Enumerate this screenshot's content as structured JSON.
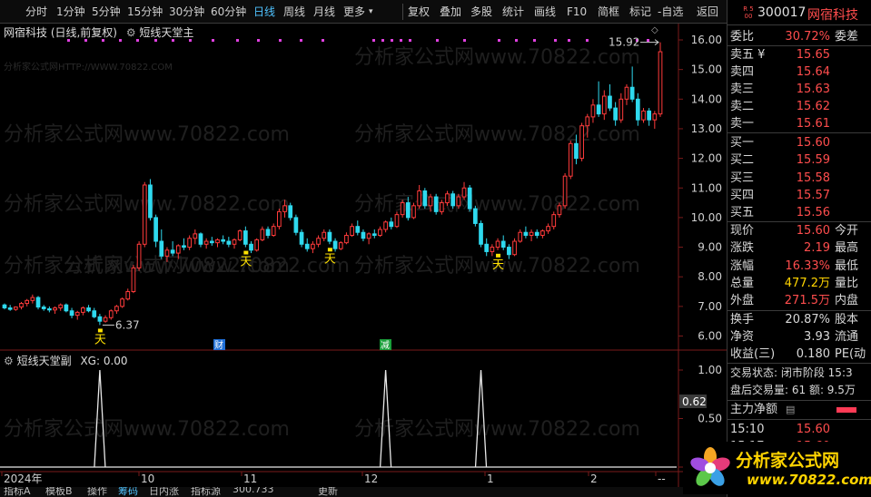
{
  "toolbar": {
    "periods": [
      "分时",
      "1分钟",
      "5分钟",
      "15分钟",
      "30分钟",
      "60分钟",
      "日线",
      "周线",
      "月线",
      "更多"
    ],
    "active_period": "日线",
    "tools": [
      "复权",
      "叠加",
      "多股",
      "统计",
      "画线",
      "F10",
      "简框",
      "标记",
      "-自选",
      "返回"
    ]
  },
  "chart": {
    "title": "网宿科技 (日线,前复权)",
    "indicator": "短线天堂主",
    "watermark": "分析家公式网www.70822.com",
    "watermark_small": "分析家公式网HTTP://WWW.70822.COM",
    "high_label": "15.92",
    "low_label": "6.37",
    "signal_char": "天",
    "event_marks": [
      {
        "text": "财",
        "color": "#1f6fd8"
      },
      {
        "text": "减",
        "color": "#1a9e3a"
      }
    ]
  },
  "subchart": {
    "title": "短线天堂副",
    "xg_label": "XG: 0.00",
    "cursor_value": "0.62"
  },
  "xaxis": {
    "labels": [
      "2024年",
      "10",
      "11",
      "12",
      "1",
      "2",
      "--"
    ]
  },
  "right_panel": {
    "badge": "R 500",
    "code": "300017",
    "name": "网宿科技",
    "webi": {
      "label": "委比",
      "value": "30.72%",
      "right": "委差"
    },
    "asks": [
      {
        "label": "卖五 ¥",
        "price": "15.65"
      },
      {
        "label": "卖四",
        "price": "15.64"
      },
      {
        "label": "卖三",
        "price": "15.63"
      },
      {
        "label": "卖二",
        "price": "15.62"
      },
      {
        "label": "卖一",
        "price": "15.61"
      }
    ],
    "bids": [
      {
        "label": "买一",
        "price": "15.60"
      },
      {
        "label": "买二",
        "price": "15.59"
      },
      {
        "label": "买三",
        "price": "15.58"
      },
      {
        "label": "买四",
        "price": "15.57"
      },
      {
        "label": "买五",
        "price": "15.56"
      }
    ],
    "stats": [
      {
        "label": "现价",
        "value": "15.60",
        "right": "今开",
        "color": "#ff4d4d"
      },
      {
        "label": "涨跌",
        "value": "2.19",
        "right": "最高",
        "color": "#ff4d4d"
      },
      {
        "label": "涨幅",
        "value": "16.33%",
        "right": "最低",
        "color": "#ff4d4d"
      },
      {
        "label": "总量",
        "value": "477.2万",
        "right": "量比",
        "color": "#ffd400"
      },
      {
        "label": "外盘",
        "value": "271.5万",
        "right": "内盘",
        "color": "#ff4d4d"
      }
    ],
    "stats2": [
      {
        "label": "换手",
        "value": "20.87%",
        "right": "股本"
      },
      {
        "label": "净资",
        "value": "3.93",
        "right": "流通"
      },
      {
        "label": "收益(三)",
        "value": "0.180",
        "right": "PE(动"
      }
    ],
    "trade_status": "交易状态: 闭市阶段 15:3",
    "after_hours": "盘后交易量: 61  额: 9.5万",
    "main_net": "主力净额",
    "ticks": [
      {
        "time": "15:10",
        "price": "15.60"
      },
      {
        "time": "15:17",
        "price": "15.60"
      }
    ]
  },
  "footer": {
    "tabs": [
      "指标A",
      "模板B",
      "操作",
      "筹码",
      "日内涨",
      "指标源",
      "300.733",
      "更新"
    ],
    "active": "筹码"
  },
  "logo": {
    "text": "分析家公式网",
    "url": "www.70822.com"
  },
  "colors": {
    "up": "#ff3b3b",
    "down": "#2fd9ee",
    "signal": "#ffe100",
    "magenta": "#e040e0",
    "accent": "#4fc3ff"
  },
  "chart_data": {
    "type": "candlestick",
    "price_axis": [
      16.0,
      15.0,
      14.0,
      13.0,
      12.0,
      11.0,
      10.0,
      9.0,
      8.0,
      7.0,
      6.0
    ],
    "sub_axis": [
      1.0,
      0.5,
      0.0
    ],
    "candles": [
      [
        7.05,
        7.1,
        6.9,
        6.95
      ],
      [
        6.95,
        7.05,
        6.85,
        6.9
      ],
      [
        6.9,
        7.0,
        6.85,
        6.98
      ],
      [
        6.98,
        7.15,
        6.9,
        7.1
      ],
      [
        7.1,
        7.25,
        7.0,
        7.2
      ],
      [
        7.2,
        7.4,
        7.1,
        7.3
      ],
      [
        7.3,
        7.35,
        6.9,
        6.98
      ],
      [
        6.98,
        7.05,
        6.85,
        6.92
      ],
      [
        6.92,
        7.0,
        6.8,
        6.88
      ],
      [
        6.88,
        7.0,
        6.75,
        6.95
      ],
      [
        6.95,
        7.1,
        6.85,
        7.05
      ],
      [
        7.05,
        7.1,
        6.8,
        6.85
      ],
      [
        6.85,
        6.95,
        6.6,
        6.7
      ],
      [
        6.7,
        6.85,
        6.55,
        6.8
      ],
      [
        6.8,
        7.0,
        6.7,
        6.95
      ],
      [
        6.95,
        7.05,
        6.8,
        6.85
      ],
      [
        6.85,
        6.95,
        6.6,
        6.65
      ],
      [
        6.65,
        6.75,
        6.37,
        6.5
      ],
      [
        6.5,
        6.7,
        6.45,
        6.62
      ],
      [
        6.62,
        6.9,
        6.55,
        6.85
      ],
      [
        6.85,
        7.05,
        6.75,
        7.0
      ],
      [
        7.0,
        7.3,
        6.95,
        7.25
      ],
      [
        7.25,
        7.6,
        7.2,
        7.5
      ],
      [
        7.5,
        8.4,
        7.45,
        8.3
      ],
      [
        8.3,
        9.2,
        8.2,
        9.1
      ],
      [
        9.1,
        11.2,
        9.0,
        11.1
      ],
      [
        11.1,
        11.3,
        9.9,
        10.0
      ],
      [
        10.0,
        10.1,
        9.0,
        9.2
      ],
      [
        9.2,
        9.6,
        8.6,
        8.7
      ],
      [
        8.7,
        9.0,
        8.5,
        8.9
      ],
      [
        8.9,
        9.2,
        8.7,
        8.8
      ],
      [
        8.8,
        9.1,
        8.6,
        9.05
      ],
      [
        9.05,
        9.3,
        8.9,
        9.0
      ],
      [
        9.0,
        9.4,
        8.9,
        9.3
      ],
      [
        9.3,
        9.6,
        9.1,
        9.45
      ],
      [
        9.45,
        9.5,
        9.0,
        9.1
      ],
      [
        9.1,
        9.3,
        8.95,
        9.2
      ],
      [
        9.2,
        9.35,
        9.05,
        9.15
      ],
      [
        9.15,
        9.3,
        9.0,
        9.25
      ],
      [
        9.25,
        9.4,
        9.1,
        9.2
      ],
      [
        9.2,
        9.35,
        9.0,
        9.1
      ],
      [
        9.1,
        9.3,
        8.95,
        9.25
      ],
      [
        9.25,
        9.6,
        9.2,
        9.55
      ],
      [
        9.55,
        9.7,
        9.0,
        9.1
      ],
      [
        9.1,
        9.2,
        8.8,
        8.9
      ],
      [
        8.9,
        9.3,
        8.85,
        9.25
      ],
      [
        9.25,
        9.7,
        9.2,
        9.6
      ],
      [
        9.6,
        9.7,
        9.3,
        9.4
      ],
      [
        9.4,
        9.8,
        9.35,
        9.7
      ],
      [
        9.7,
        10.3,
        9.6,
        10.2
      ],
      [
        10.2,
        10.6,
        10.0,
        10.4
      ],
      [
        10.4,
        10.5,
        9.9,
        10.0
      ],
      [
        10.0,
        10.1,
        9.4,
        9.5
      ],
      [
        9.5,
        9.6,
        9.0,
        9.1
      ],
      [
        9.1,
        9.3,
        8.85,
        8.95
      ],
      [
        8.95,
        9.2,
        8.8,
        9.1
      ],
      [
        9.1,
        9.4,
        9.0,
        9.3
      ],
      [
        9.3,
        9.6,
        9.2,
        9.5
      ],
      [
        9.5,
        9.6,
        9.1,
        9.2
      ],
      [
        9.2,
        9.3,
        8.85,
        8.95
      ],
      [
        8.95,
        9.2,
        8.9,
        9.15
      ],
      [
        9.15,
        9.5,
        9.1,
        9.4
      ],
      [
        9.4,
        9.8,
        9.35,
        9.7
      ],
      [
        9.7,
        9.9,
        9.4,
        9.5
      ],
      [
        9.5,
        9.6,
        9.2,
        9.3
      ],
      [
        9.3,
        9.5,
        9.1,
        9.45
      ],
      [
        9.45,
        9.6,
        9.3,
        9.4
      ],
      [
        9.4,
        9.7,
        9.35,
        9.6
      ],
      [
        9.6,
        9.9,
        9.5,
        9.85
      ],
      [
        9.85,
        10.0,
        9.6,
        9.7
      ],
      [
        9.7,
        10.2,
        9.65,
        10.1
      ],
      [
        10.1,
        10.6,
        10.0,
        10.5
      ],
      [
        10.5,
        10.7,
        9.9,
        10.0
      ],
      [
        10.0,
        10.5,
        9.95,
        10.4
      ],
      [
        10.4,
        11.1,
        10.3,
        10.9
      ],
      [
        10.9,
        11.0,
        10.3,
        10.4
      ],
      [
        10.4,
        10.8,
        10.2,
        10.7
      ],
      [
        10.7,
        10.8,
        10.1,
        10.2
      ],
      [
        10.2,
        10.6,
        10.1,
        10.5
      ],
      [
        10.5,
        10.9,
        10.4,
        10.8
      ],
      [
        10.8,
        10.9,
        10.3,
        10.4
      ],
      [
        10.4,
        10.8,
        10.3,
        10.7
      ],
      [
        10.7,
        11.2,
        10.6,
        11.0
      ],
      [
        11.0,
        11.1,
        10.2,
        10.3
      ],
      [
        10.3,
        10.4,
        9.7,
        9.8
      ],
      [
        9.8,
        9.9,
        9.0,
        9.1
      ],
      [
        9.1,
        9.3,
        8.7,
        8.85
      ],
      [
        8.85,
        9.1,
        8.7,
        9.0
      ],
      [
        9.0,
        9.3,
        8.9,
        9.2
      ],
      [
        9.2,
        9.4,
        8.9,
        9.0
      ],
      [
        9.0,
        9.1,
        8.6,
        8.75
      ],
      [
        8.75,
        9.3,
        8.7,
        9.2
      ],
      [
        9.2,
        9.6,
        9.15,
        9.5
      ],
      [
        9.5,
        9.7,
        9.3,
        9.4
      ],
      [
        9.4,
        9.6,
        9.2,
        9.5
      ],
      [
        9.5,
        9.6,
        9.3,
        9.4
      ],
      [
        9.4,
        9.6,
        9.3,
        9.55
      ],
      [
        9.55,
        9.8,
        9.45,
        9.7
      ],
      [
        9.7,
        10.2,
        9.6,
        10.1
      ],
      [
        10.1,
        10.5,
        10.0,
        10.4
      ],
      [
        10.4,
        11.5,
        10.3,
        11.4
      ],
      [
        11.4,
        12.6,
        11.3,
        12.5
      ],
      [
        12.5,
        12.8,
        11.8,
        12.0
      ],
      [
        12.0,
        13.2,
        11.9,
        13.1
      ],
      [
        13.1,
        13.5,
        12.7,
        13.4
      ],
      [
        13.4,
        14.0,
        13.2,
        13.8
      ],
      [
        13.8,
        14.6,
        13.4,
        13.5
      ],
      [
        13.5,
        14.3,
        13.3,
        14.1
      ],
      [
        14.1,
        14.5,
        13.6,
        13.7
      ],
      [
        13.7,
        13.9,
        13.1,
        13.3
      ],
      [
        13.3,
        14.2,
        13.2,
        14.0
      ],
      [
        14.0,
        14.5,
        13.8,
        14.4
      ],
      [
        14.4,
        15.1,
        13.9,
        14.0
      ],
      [
        14.0,
        14.2,
        13.1,
        13.3
      ],
      [
        13.3,
        13.7,
        13.2,
        13.6
      ],
      [
        13.6,
        13.7,
        13.1,
        13.3
      ],
      [
        13.3,
        13.6,
        13.0,
        13.5
      ],
      [
        13.5,
        15.92,
        13.4,
        15.6
      ]
    ],
    "signal_markers": [
      17,
      43,
      58,
      88
    ],
    "pulses": [
      17,
      68,
      85,
      137
    ],
    "magenta_dots_top": true
  }
}
